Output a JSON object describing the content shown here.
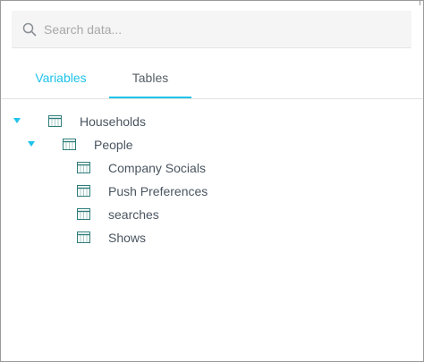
{
  "search": {
    "placeholder": "Search data...",
    "value": ""
  },
  "tabs": [
    {
      "label": "Variables",
      "active": false
    },
    {
      "label": "Tables",
      "active": true
    }
  ],
  "tree": [
    {
      "label": "Households",
      "expanded": true,
      "level": 0
    },
    {
      "label": "People",
      "expanded": true,
      "level": 1
    },
    {
      "label": "Company Socials",
      "level": 2
    },
    {
      "label": "Push Preferences",
      "level": 2
    },
    {
      "label": "searches",
      "level": 2
    },
    {
      "label": "Shows",
      "level": 2
    }
  ],
  "colors": {
    "accent": "#1fc3ea",
    "icon": "#2e7d7a",
    "text": "#4a5560"
  },
  "icons": {
    "search": "magnifier-icon",
    "expand": "caret-down-icon",
    "table": "table-grid-icon"
  }
}
